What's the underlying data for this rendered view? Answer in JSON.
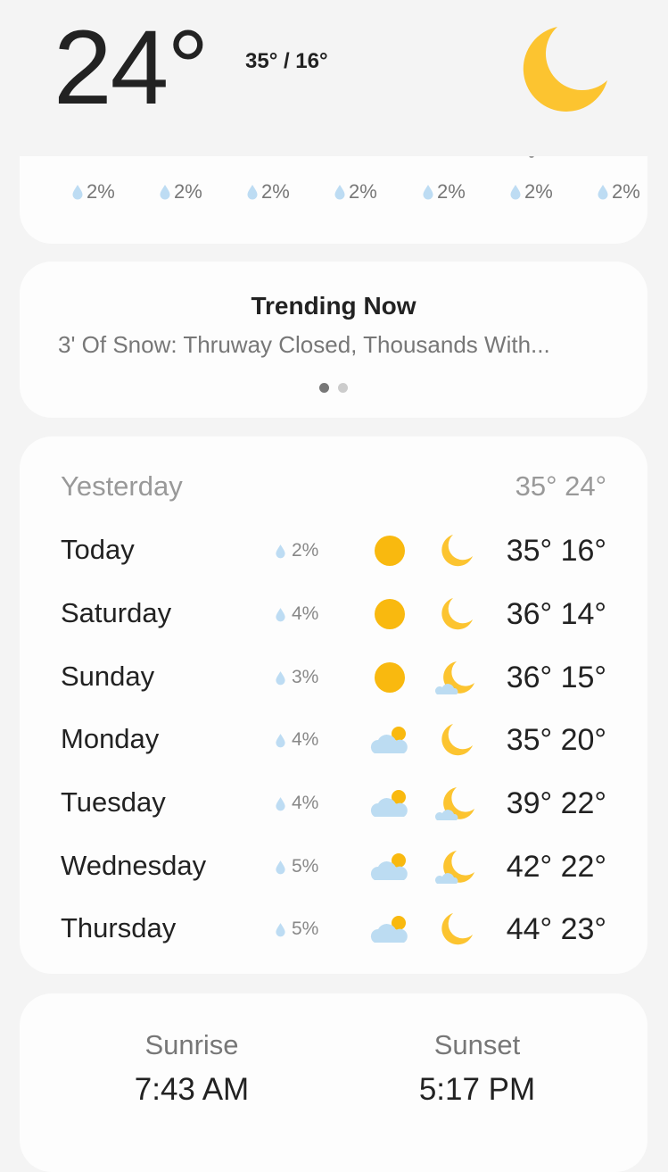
{
  "current": {
    "temp": "24°",
    "hilo": "35° / 16°",
    "icon": "moon-icon"
  },
  "precip_strip": [
    "2%",
    "2%",
    "2%",
    "2%",
    "2%",
    "2%",
    "2%"
  ],
  "trending": {
    "title": "Trending Now",
    "headline": "3' Of Snow: Thruway Closed, Thousands With..."
  },
  "forecast": {
    "yesterday": {
      "label": "Yesterday",
      "temps": "35° 24°"
    },
    "days": [
      {
        "day": "Today",
        "rain": "2%",
        "day_icon": "sun-icon",
        "night_icon": "moon-icon",
        "temps": "35° 16°"
      },
      {
        "day": "Saturday",
        "rain": "4%",
        "day_icon": "sun-icon",
        "night_icon": "moon-icon",
        "temps": "36° 14°"
      },
      {
        "day": "Sunday",
        "rain": "3%",
        "day_icon": "sun-icon",
        "night_icon": "moon-cloud-icon",
        "temps": "36° 15°"
      },
      {
        "day": "Monday",
        "rain": "4%",
        "day_icon": "cloud-sun-icon",
        "night_icon": "moon-icon",
        "temps": "35° 20°"
      },
      {
        "day": "Tuesday",
        "rain": "4%",
        "day_icon": "cloud-sun-icon",
        "night_icon": "moon-cloud-icon",
        "temps": "39° 22°"
      },
      {
        "day": "Wednesday",
        "rain": "5%",
        "day_icon": "cloud-sun-icon",
        "night_icon": "moon-cloud-icon",
        "temps": "42° 22°"
      },
      {
        "day": "Thursday",
        "rain": "5%",
        "day_icon": "cloud-sun-icon",
        "night_icon": "moon-icon",
        "temps": "44° 23°"
      }
    ]
  },
  "sun": {
    "sunrise_label": "Sunrise",
    "sunrise_time": "7:43 AM",
    "sunset_label": "Sunset",
    "sunset_time": "5:17 PM"
  },
  "colors": {
    "sun": "#f9b90f",
    "moon": "#fcc430",
    "cloud": "#bcdcf2",
    "drop": "#bddcf3",
    "card": "#fdfdfd",
    "background": "#f4f4f4"
  }
}
